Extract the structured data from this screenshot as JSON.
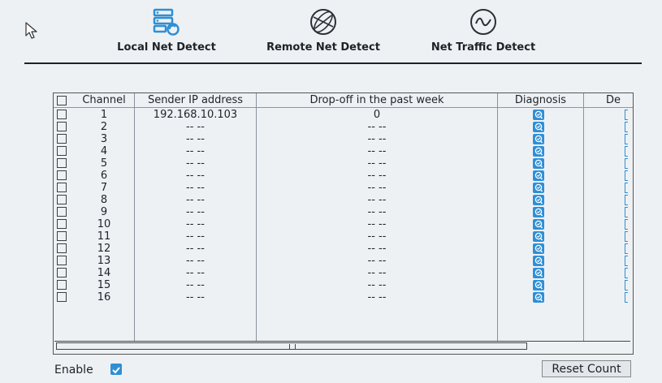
{
  "tabs": [
    {
      "label": "Local Net Detect",
      "icon": "local-net-icon"
    },
    {
      "label": "Remote Net Detect",
      "icon": "globe-icon"
    },
    {
      "label": "Net Traffic Detect",
      "icon": "traffic-wave-icon"
    }
  ],
  "table": {
    "headers": [
      "Channel",
      "Sender IP address",
      "Drop-off in the past week",
      "Diagnosis",
      "De"
    ],
    "rows": [
      {
        "channel": "1",
        "ip": "192.168.10.103",
        "dropoff": "0"
      },
      {
        "channel": "2",
        "ip": "-- --",
        "dropoff": "-- --"
      },
      {
        "channel": "3",
        "ip": "-- --",
        "dropoff": "-- --"
      },
      {
        "channel": "4",
        "ip": "-- --",
        "dropoff": "-- --"
      },
      {
        "channel": "5",
        "ip": "-- --",
        "dropoff": "-- --"
      },
      {
        "channel": "6",
        "ip": "-- --",
        "dropoff": "-- --"
      },
      {
        "channel": "7",
        "ip": "-- --",
        "dropoff": "-- --"
      },
      {
        "channel": "8",
        "ip": "-- --",
        "dropoff": "-- --"
      },
      {
        "channel": "9",
        "ip": "-- --",
        "dropoff": "-- --"
      },
      {
        "channel": "10",
        "ip": "-- --",
        "dropoff": "-- --"
      },
      {
        "channel": "11",
        "ip": "-- --",
        "dropoff": "-- --"
      },
      {
        "channel": "12",
        "ip": "-- --",
        "dropoff": "-- --"
      },
      {
        "channel": "13",
        "ip": "-- --",
        "dropoff": "-- --"
      },
      {
        "channel": "14",
        "ip": "-- --",
        "dropoff": "-- --"
      },
      {
        "channel": "15",
        "ip": "-- --",
        "dropoff": "-- --"
      },
      {
        "channel": "16",
        "ip": "-- --",
        "dropoff": "-- --"
      }
    ]
  },
  "footer": {
    "enable_label": "Enable",
    "enable_checked": true,
    "reset_label": "Reset Count"
  },
  "colors": {
    "accent": "#2e8fd6",
    "background": "#eef1f4"
  }
}
